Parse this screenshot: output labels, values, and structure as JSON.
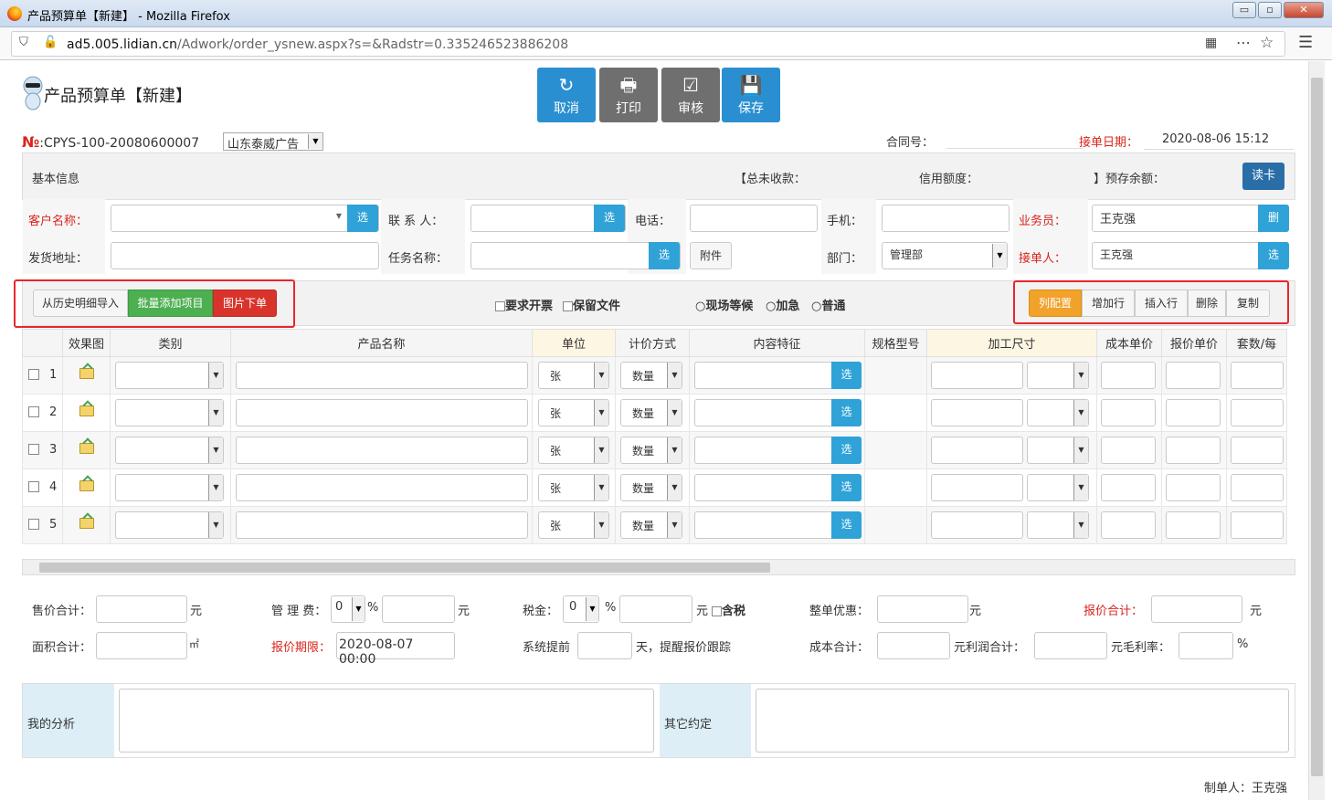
{
  "window": {
    "title": "产品预算单【新建】 - Mozilla Firefox",
    "min": "▭",
    "restore": "▫",
    "close": "✕"
  },
  "urlbar": {
    "url_host": "ad5.005.lidian.cn",
    "url_path": "/Adwork/order_ysnew.aspx?s=&Radstr=0.335246523886208"
  },
  "header": {
    "title": "产品预算单【新建】"
  },
  "toolbar": [
    {
      "label": "取消",
      "icon": "↻"
    },
    {
      "label": "打印",
      "icon": "🖶"
    },
    {
      "label": "审核",
      "icon": "☑"
    },
    {
      "label": "保存",
      "icon": "💾"
    }
  ],
  "order": {
    "no_prefix": "№",
    "no": ":CPYS-100-20080600007",
    "company": "山东泰威广告",
    "contract_label": "合同号：",
    "date_label": "接单日期：",
    "date": "2020-08-06 15:12"
  },
  "basic": {
    "title": "基本信息",
    "total_unpaid": "【总未收款：",
    "credit": "信用额度：",
    "prepaid": "】预存余额：",
    "read_card": "读卡"
  },
  "form": {
    "customer": "客户名称：",
    "contact": "联 系 人：",
    "phone": "电话：",
    "mobile": "手机：",
    "salesman": "业务员：",
    "salesman_val": "王克强",
    "address": "发货地址：",
    "task": "任务名称：",
    "attach": "附件",
    "dept": "部门：",
    "dept_val": "管理部",
    "receiver": "接单人：",
    "receiver_val": "王克强",
    "sel": "选",
    "del": "删"
  },
  "actions": {
    "history": "从历史明细导入",
    "batch": "批量添加项目",
    "image": "图片下单",
    "invoice": "要求开票",
    "keep": "保留文件",
    "onsite": "现场等候",
    "urgent": "加急",
    "normal": "普通",
    "colcfg": "列配置",
    "addrow": "增加行",
    "insrow": "插入行",
    "delete": "删除",
    "copy": "复制"
  },
  "grid": {
    "columns": [
      "",
      "效果图",
      "类别",
      "产品名称",
      "单位",
      "计价方式",
      "内容特征",
      "规格型号",
      "加工尺寸",
      "成本单价",
      "报价单价",
      "套数/每"
    ],
    "rows": [
      {
        "n": "1",
        "unit": "张",
        "price": "数量"
      },
      {
        "n": "2",
        "unit": "张",
        "price": "数量"
      },
      {
        "n": "3",
        "unit": "张",
        "price": "数量"
      },
      {
        "n": "4",
        "unit": "张",
        "price": "数量"
      },
      {
        "n": "5",
        "unit": "张",
        "price": "数量"
      }
    ]
  },
  "summary": {
    "sale_total": "售价合计：",
    "yuan": "元",
    "mgmt_fee": "管 理 费：",
    "mgmt_val": "0",
    "pct": "%",
    "tax": "税金：",
    "tax_val": "0",
    "tax_incl": "含税",
    "discount": "整单优惠：",
    "quote_total": "报价合计：",
    "area_total": "面积合计：",
    "sqm": "㎡",
    "quote_deadline": "报价期限：",
    "deadline_val": "2020-08-07 00:00",
    "remind": "系统提前",
    "remind2": "天，提醒报价跟踪",
    "cost_total": "成本合计：",
    "profit": "元利润合计：",
    "margin": "元毛利率："
  },
  "notes": {
    "analysis": "我的分析",
    "other": "其它约定"
  },
  "footer": {
    "maker": "制单人：王克强"
  }
}
